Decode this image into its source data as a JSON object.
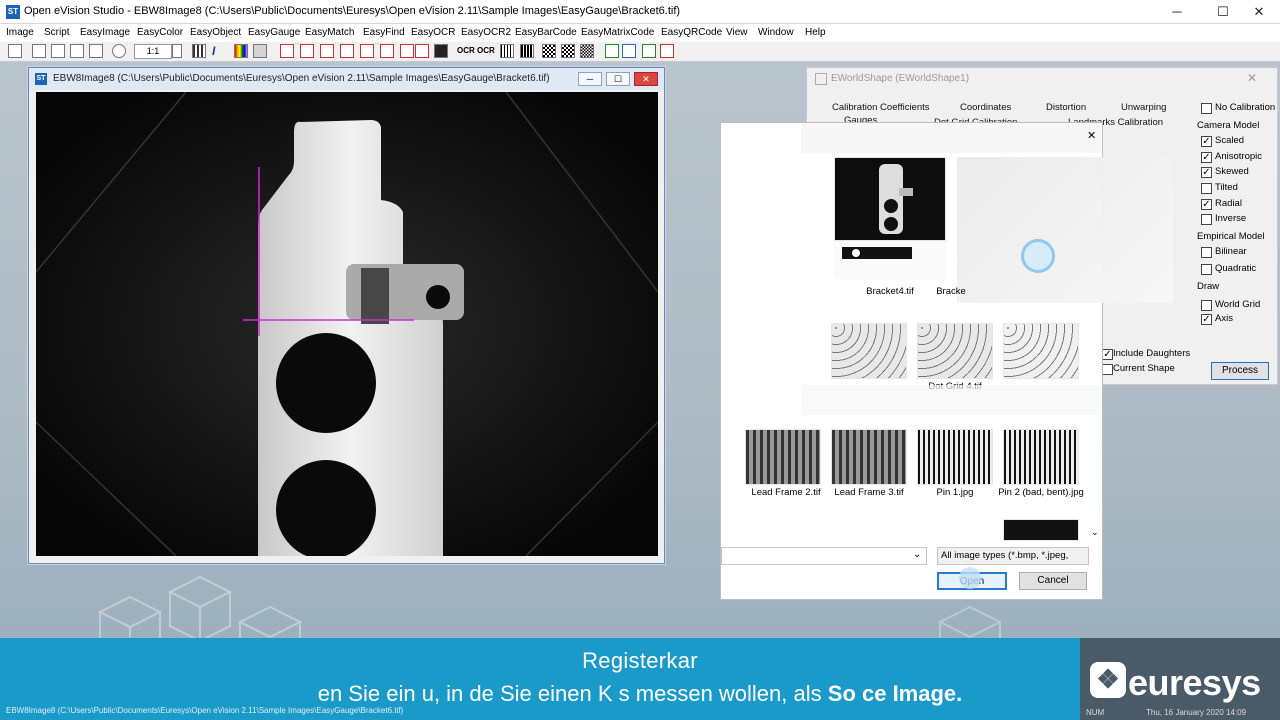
{
  "app": {
    "title": "Open eVision Studio - EBW8Image8 (C:\\Users\\Public\\Documents\\Euresys\\Open eVision 2.11\\Sample Images\\EasyGauge\\Bracket6.tif)",
    "icon_text": "ST"
  },
  "window_controls": {
    "minimize": "─",
    "maximize": "☐",
    "close": "✕"
  },
  "menu": [
    "Image",
    "Script",
    "EasyImage",
    "EasyColor",
    "EasyObject",
    "EasyGauge",
    "EasyMatch",
    "EasyFind",
    "EasyOCR",
    "EasyOCR2",
    "EasyBarCode",
    "EasyMatrixCode",
    "EasyQRCode",
    "View",
    "Window",
    "Help"
  ],
  "toolbar": {
    "zoom_value": "1:1"
  },
  "image_window": {
    "title": "EBW8Image8 (C:\\Users\\Public\\Documents\\Euresys\\Open eVision 2.11\\Sample Images\\EasyGauge\\Bracket6.tif)"
  },
  "worldshape": {
    "title": "EWorldShape (EWorldShape1)",
    "tabs_row1": [
      "Calibration Coefficients",
      "Coordinates",
      "Distortion",
      "Unwarping"
    ],
    "tabs_row2": [
      "Gauges",
      "Dot Grid Calibration",
      "Landmarks Calibration"
    ],
    "no_calibration": "No Calibration",
    "camera_model": {
      "label": "Camera Model",
      "items": [
        {
          "label": "Scaled",
          "checked": "✓"
        },
        {
          "label": "Anisotropic",
          "checked": "✓"
        },
        {
          "label": "Skewed",
          "checked": "✓"
        },
        {
          "label": "Tilted",
          "checked": ""
        },
        {
          "label": "Radial",
          "checked": "✓"
        },
        {
          "label": "Inverse",
          "checked": ""
        }
      ]
    },
    "empirical_model": {
      "label": "Empirical Model",
      "items": [
        {
          "label": "Bilinear",
          "checked": ""
        },
        {
          "label": "Quadratic",
          "checked": ""
        }
      ]
    },
    "draw": {
      "label": "Draw",
      "items": [
        {
          "label": "World Grid",
          "checked": ""
        },
        {
          "label": "Axis",
          "checked": "✓"
        }
      ]
    },
    "include_daughters": "Include Daughters",
    "current_shape": "Current Shape",
    "process_button": "Process"
  },
  "file_dialog": {
    "close": "✕",
    "files": [
      "Bracket4.tif",
      "Bracke",
      "Dot Grid 4.tif",
      "Lead Frame 2.tif",
      "Lead Frame 3.tif",
      "Pin 1.jpg",
      "Pin 2 (bad, bent).jpg"
    ],
    "filetype": "All image types (*.bmp, *.jpeg,",
    "open_button": "Open",
    "cancel_button": "Cancel"
  },
  "caption": {
    "line1": "Registerkar",
    "line2_a": "en Sie ein",
    "line2_b": "u, in de",
    "line2_c": "Sie einen K",
    "line2_d": "s messen wollen, als",
    "line2_bold": "So     ce Image."
  },
  "logo": {
    "text": "euresys",
    "mark": "❖"
  },
  "status": {
    "text": "EBW8Image8 (C:\\Users\\Public\\Documents\\Euresys\\Open eVision 2.11\\Sample Images\\EasyGauge\\Bracket6.tif)",
    "num": "NUM",
    "date": "Thu, 16 January 2020  14:09"
  },
  "colors": {
    "accent": "#1a9ac9",
    "magenta": "#d12ad1",
    "logo_bg": "#4a5a66"
  }
}
